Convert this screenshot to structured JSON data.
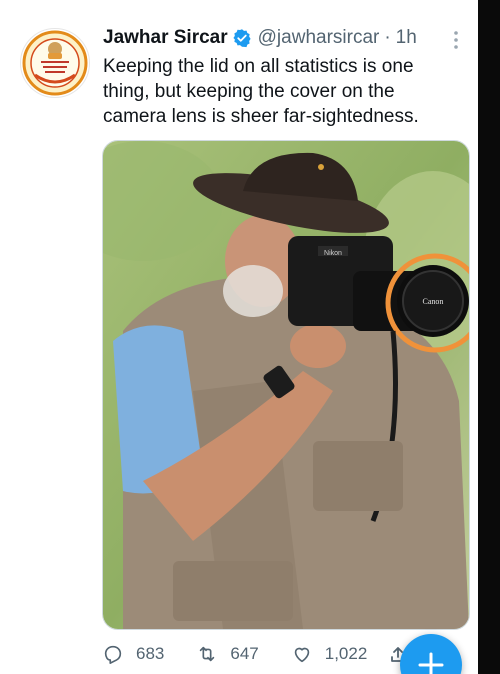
{
  "tweet": {
    "author_name": "Jawhar Sircar",
    "handle": "@jawharsircar",
    "separator": "·",
    "time": "1h",
    "text": "Keeping the lid on all statistics is one\nthing, but keeping the cover on the\ncamera lens is sheer far-sightedness.",
    "media": {
      "camera_brand": "Canon",
      "camera_top_label": "Nikon"
    }
  },
  "actions": {
    "replies": "683",
    "retweets": "647",
    "likes": "1,022"
  },
  "colors": {
    "accent": "#1d9bf0",
    "highlight_circle": "#f0923a",
    "muted_text": "#536471"
  },
  "icons": {
    "verified": "verified-badge-icon",
    "more": "more-options-icon",
    "reply": "reply-icon",
    "retweet": "retweet-icon",
    "like": "heart-icon",
    "share": "share-icon",
    "compose": "plus-icon"
  }
}
